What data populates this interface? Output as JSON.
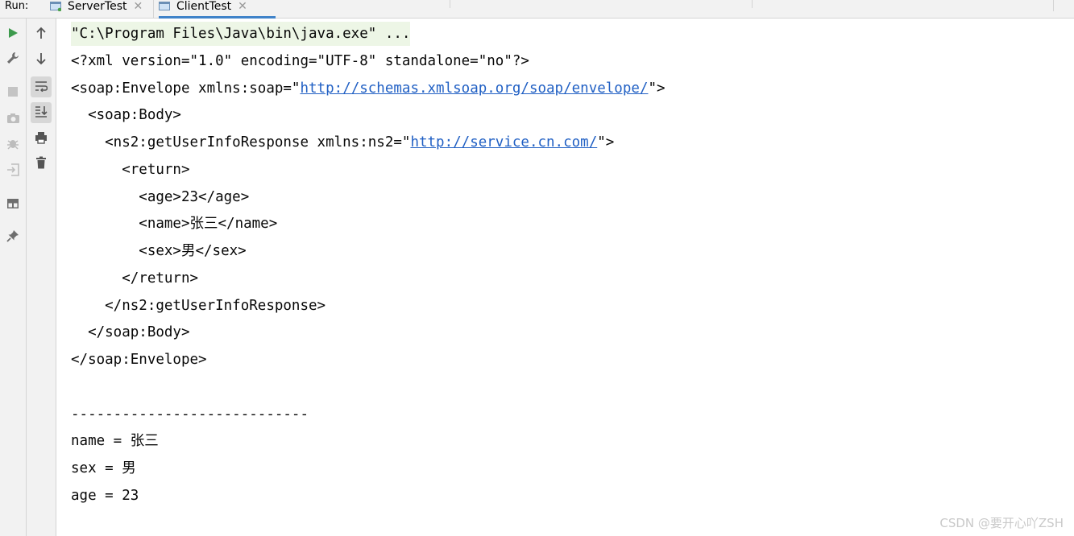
{
  "toolbar": {
    "run_label": "Run:"
  },
  "tabs": [
    {
      "label": "ServerTest",
      "close": "✕"
    },
    {
      "label": "ClientTest",
      "close": "✕"
    }
  ],
  "left_actions": [
    "rerun-icon",
    "wrench-icon",
    "stop-icon",
    "camera-icon",
    "debug-icon",
    "exit-icon",
    "layout-icon",
    "pin-icon"
  ],
  "console_actions": [
    "arrow-up-icon",
    "arrow-down-icon",
    "soft-wrap-icon",
    "scroll-to-end-icon",
    "print-icon",
    "trash-icon"
  ],
  "console": {
    "command": "\"C:\\Program Files\\Java\\bin\\java.exe\" ...",
    "xml_decl": "<?xml version=\"1.0\" encoding=\"UTF-8\" standalone=\"no\"?>",
    "envelope_open_pre": "<soap:Envelope xmlns:soap=\"",
    "envelope_url": "http://schemas.xmlsoap.org/soap/envelope/",
    "envelope_open_post": "\">",
    "body_open": "  <soap:Body>",
    "resp_open_pre": "    <ns2:getUserInfoResponse xmlns:ns2=\"",
    "resp_url": "http://service.cn.com/",
    "resp_open_post": "\">",
    "return_open": "      <return>",
    "age_line": "        <age>23</age>",
    "name_line": "        <name>张三</name>",
    "sex_line": "        <sex>男</sex>",
    "return_close": "      </return>",
    "resp_close": "    </ns2:getUserInfoResponse>",
    "body_close": "  </soap:Body>",
    "envelope_close": "</soap:Envelope>",
    "divider": "----------------------------",
    "out_name": "name = 张三",
    "out_sex": "sex = 男",
    "out_age": "age = 23"
  },
  "watermark": "CSDN @要开心吖ZSH"
}
